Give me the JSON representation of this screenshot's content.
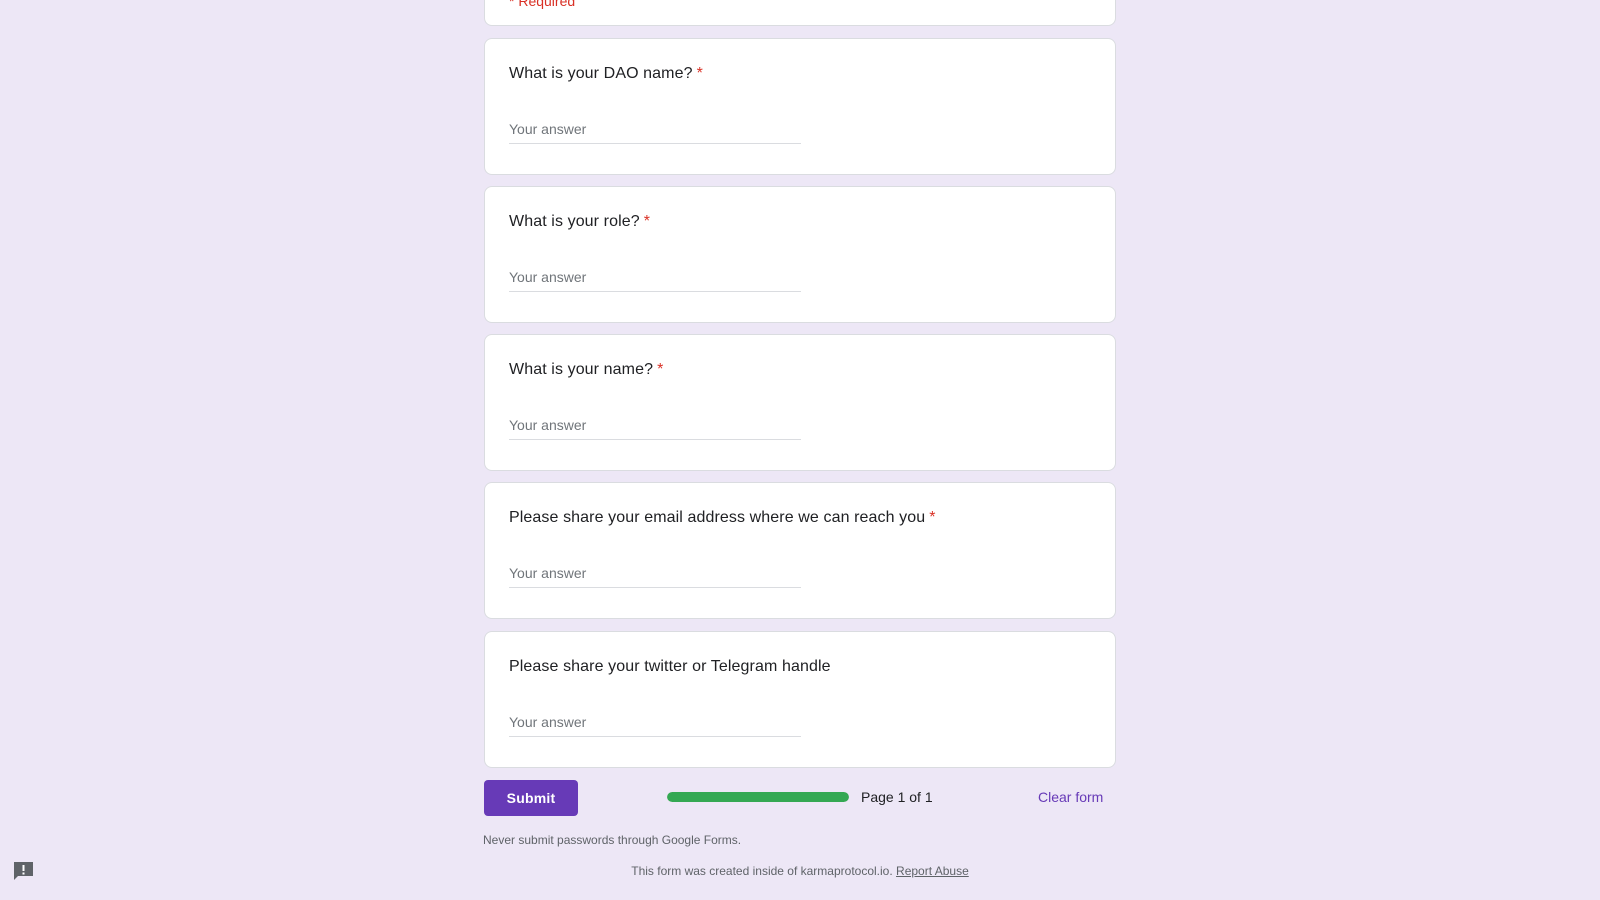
{
  "form": {
    "required_note": "* Required",
    "questions": [
      {
        "title": "What is your DAO name?",
        "required_mark": "*",
        "placeholder": "Your answer"
      },
      {
        "title": "What is your role?",
        "required_mark": "*",
        "placeholder": "Your answer"
      },
      {
        "title": "What is your name?",
        "required_mark": "*",
        "placeholder": "Your answer"
      },
      {
        "title": "Please share your email address where we can reach you",
        "required_mark": "*",
        "placeholder": "Your answer"
      },
      {
        "title": "Please share your twitter or Telegram handle",
        "required_mark": "",
        "placeholder": "Your answer"
      }
    ]
  },
  "actions": {
    "submit_label": "Submit",
    "progress_fraction": 1.0,
    "page_label": "Page 1 of 1",
    "clear_label": "Clear form"
  },
  "footer": {
    "password_note": "Never submit passwords through Google Forms.",
    "created_text": "This form was created inside of karmaprotocol.io.",
    "report_link": "Report Abuse"
  },
  "icons": {
    "report": "report-problem-icon"
  },
  "colors": {
    "background": "#ede7f6",
    "accent": "#673ab7",
    "required": "#d93025",
    "progress": "#34a853"
  }
}
